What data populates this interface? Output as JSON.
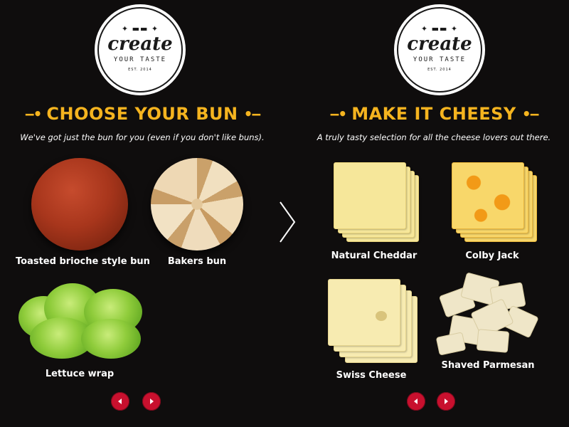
{
  "left": {
    "logo": {
      "script": "create",
      "sub": "YOUR TASTE",
      "est": "EST. 2014"
    },
    "title": "CHOOSE YOUR BUN",
    "subtitle": "We've got just the bun for you (even if you don't like buns).",
    "items": [
      {
        "label": "Toasted brioche style bun",
        "image": "brioche-bun"
      },
      {
        "label": "Bakers bun",
        "image": "bakers-bun"
      },
      {
        "label": "Lettuce wrap",
        "image": "lettuce"
      }
    ]
  },
  "right": {
    "logo": {
      "script": "create",
      "sub": "YOUR TASTE",
      "est": "EST. 2014"
    },
    "title": "MAKE IT CHEESY",
    "subtitle": "A truly tasty selection for all the cheese lovers out there.",
    "items": [
      {
        "label": "Natural Cheddar",
        "image": "cheddar-slices"
      },
      {
        "label": "Colby Jack",
        "image": "colby-jack-slices"
      },
      {
        "label": "Swiss Cheese",
        "image": "swiss-slices"
      },
      {
        "label": "Shaved Parmesan",
        "image": "parmesan-shavings"
      }
    ]
  },
  "icons": {
    "divider": "chevron-right-icon",
    "prev": "triangle-left-icon",
    "next": "triangle-right-icon"
  },
  "colors": {
    "background": "#0f0d0d",
    "accent": "#f5b41f",
    "nav_button": "#c8102e"
  }
}
